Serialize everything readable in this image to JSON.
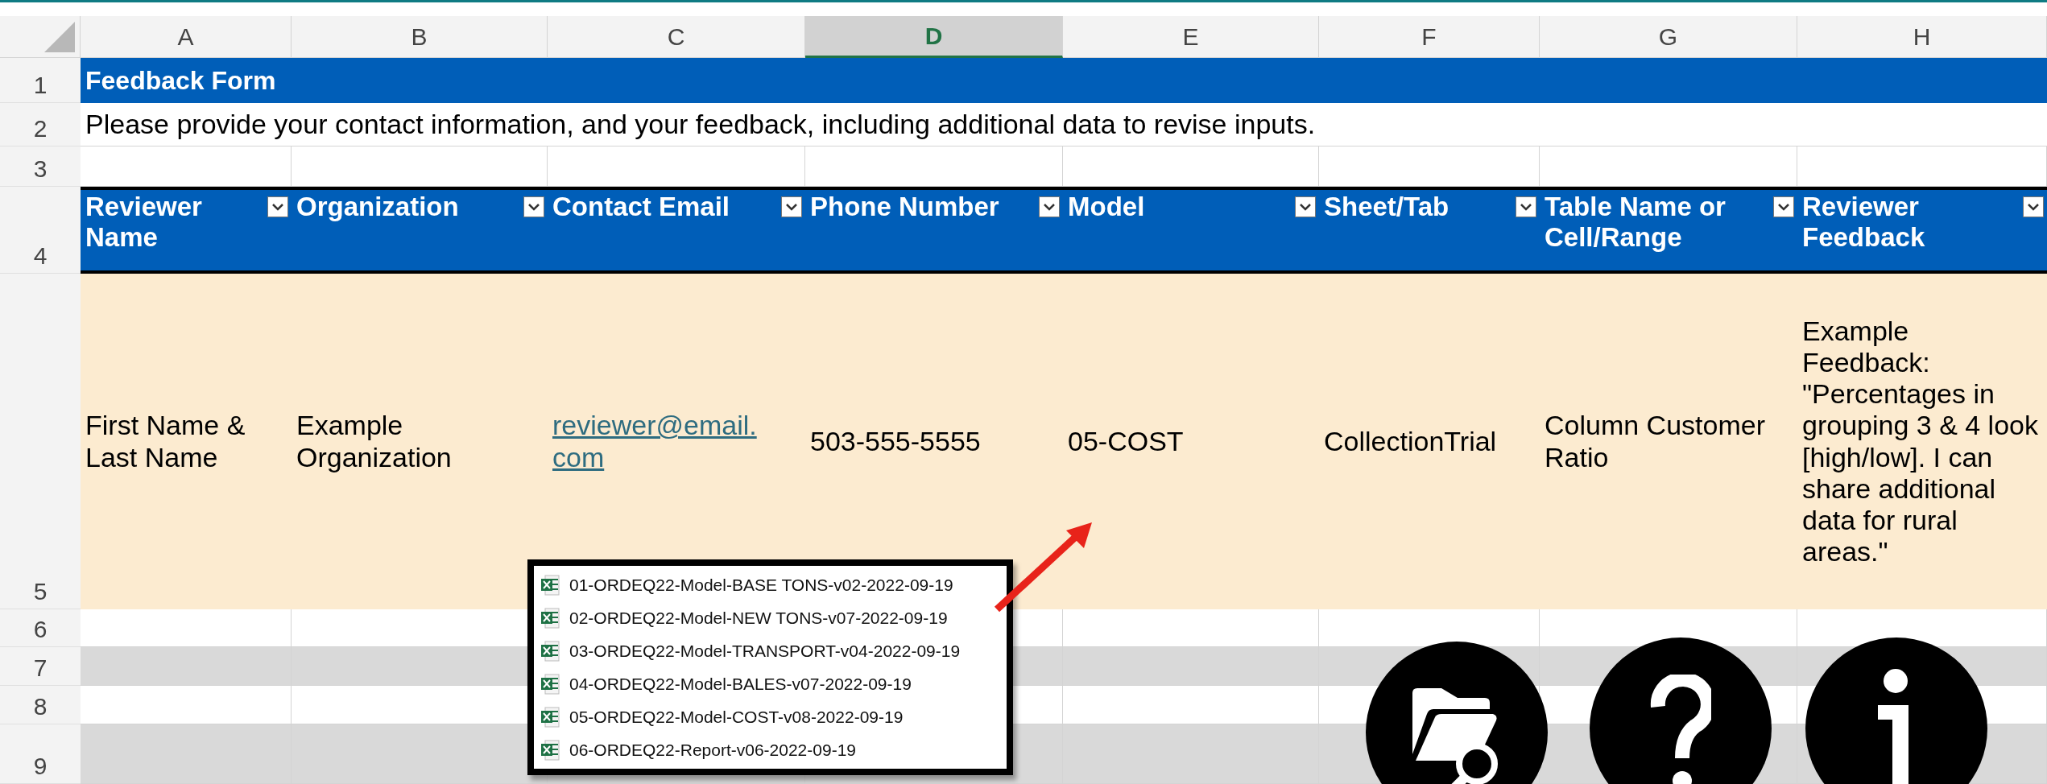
{
  "columns": [
    {
      "label": "A",
      "selected": false
    },
    {
      "label": "B",
      "selected": false
    },
    {
      "label": "C",
      "selected": false
    },
    {
      "label": "D",
      "selected": true
    },
    {
      "label": "E",
      "selected": false
    },
    {
      "label": "F",
      "selected": false
    },
    {
      "label": "G",
      "selected": false
    },
    {
      "label": "H",
      "selected": false
    }
  ],
  "row_numbers": [
    "1",
    "2",
    "3",
    "4",
    "5",
    "6",
    "7",
    "8",
    "9"
  ],
  "title": "Feedback Form",
  "instructions": "Please provide your contact information, and your feedback, including additional data to revise inputs.",
  "table": {
    "headers": [
      "Reviewer Name",
      "Organization",
      "Contact Email",
      "Phone Number",
      "Model",
      "Sheet/Tab",
      "Table Name or Cell/Range",
      "Reviewer Feedback"
    ],
    "rows": [
      {
        "cells": [
          {
            "kind": "text",
            "text": "First Name & Last Name"
          },
          {
            "kind": "text",
            "text": "Example Organization"
          },
          {
            "kind": "link",
            "text": "reviewer@email.com"
          },
          {
            "kind": "text",
            "text": "503-555-5555"
          },
          {
            "kind": "text",
            "text": "05-COST"
          },
          {
            "kind": "text",
            "text": "CollectionTrial"
          },
          {
            "kind": "text",
            "text": "Column Customer Ratio"
          },
          {
            "kind": "text",
            "text": "Example Feedback: \"Percentages in grouping 3 & 4 look [high/low]. I can share additional data for rural areas.\""
          }
        ]
      }
    ]
  },
  "file_list": [
    "01-ORDEQ22-Model-BASE TONS-v02-2022-09-19",
    "02-ORDEQ22-Model-NEW TONS-v07-2022-09-19",
    "03-ORDEQ22-Model-TRANSPORT-v04-2022-09-19",
    "04-ORDEQ22-Model-BALES-v07-2022-09-19",
    "05-ORDEQ22-Model-COST-v08-2022-09-19",
    "06-ORDEQ22-Report-v06-2022-09-19"
  ],
  "icon_buttons": [
    {
      "kind": "browse"
    },
    {
      "kind": "help"
    },
    {
      "kind": "info"
    }
  ]
}
